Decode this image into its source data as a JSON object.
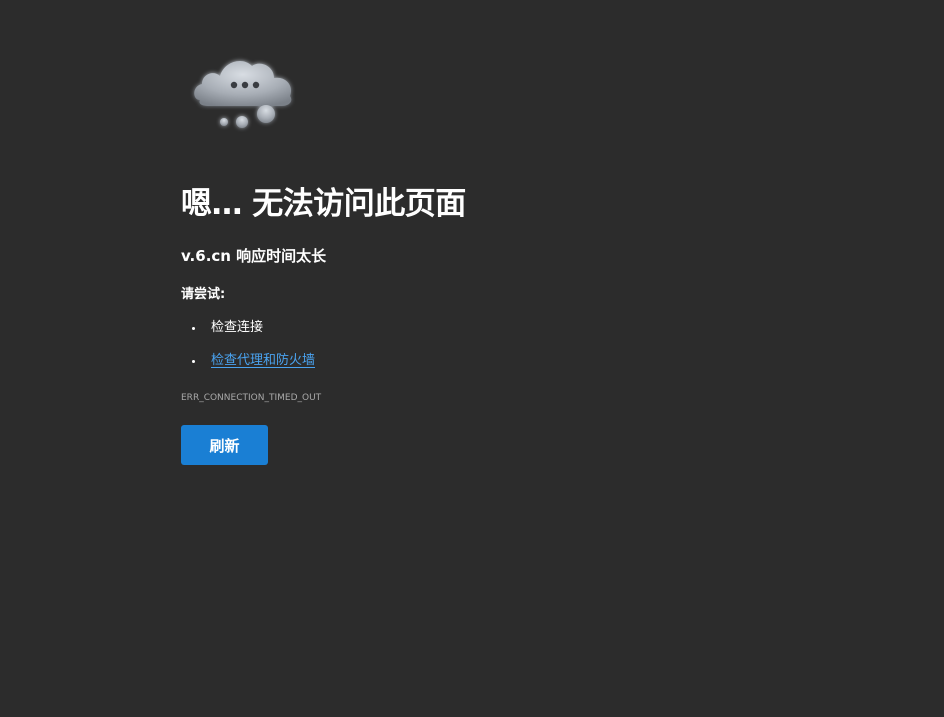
{
  "error_page": {
    "icon": "thinking-cloud-icon",
    "title": "嗯… 无法访问此页面",
    "subtitle": "v.6.cn 响应时间太长",
    "try_label": "请尝试:",
    "suggestions": [
      {
        "label": "检查连接",
        "is_link": false
      },
      {
        "label": "检查代理和防火墙",
        "is_link": true
      }
    ],
    "error_code": "ERR_CONNECTION_TIMED_OUT",
    "refresh_label": "刷新"
  },
  "colors": {
    "background": "#2c2c2c",
    "text": "#ffffff",
    "link": "#4aa3f0",
    "error_code": "#a8a8a8",
    "button": "#1a7fd4"
  }
}
